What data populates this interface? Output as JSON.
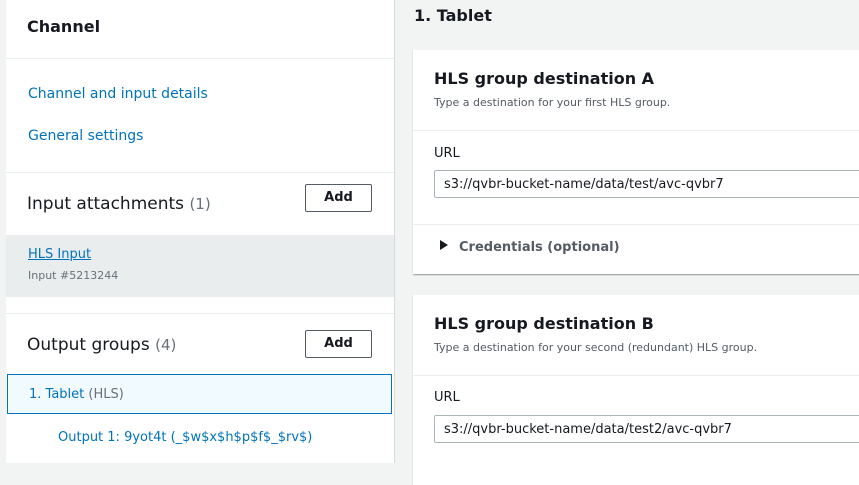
{
  "sidebar": {
    "title": "Channel",
    "links": [
      "Channel and input details",
      "General settings"
    ],
    "input_attachments": {
      "label": "Input attachments",
      "count": "(1)",
      "add_label": "Add",
      "items": [
        {
          "name": "HLS Input",
          "sub": "Input #5213244"
        }
      ]
    },
    "output_groups": {
      "label": "Output groups",
      "count": "(4)",
      "add_label": "Add",
      "selected": {
        "name": "1. Tablet",
        "type": "(HLS)"
      },
      "output_item": "Output 1: 9yot4t",
      "output_item_detail": "(_$w$x$h$p$f$_$rv$)"
    }
  },
  "main": {
    "section_title": "1. Tablet",
    "cards": [
      {
        "title": "HLS group destination A",
        "description": "Type a destination for your first HLS group.",
        "url_label": "URL",
        "url_value": "s3://qvbr-bucket-name/data/test/avc-qvbr7",
        "credentials_label": "Credentials (optional)"
      },
      {
        "title": "HLS group destination B",
        "description": "Type a destination for your second (redundant) HLS group.",
        "url_label": "URL",
        "url_value": "s3://qvbr-bucket-name/data/test2/avc-qvbr7"
      }
    ]
  },
  "colors": {
    "link": "#0073bb",
    "selected_bg": "#f1faff",
    "page_bg": "#f2f3f3",
    "input_item_bg": "#eaeded"
  }
}
